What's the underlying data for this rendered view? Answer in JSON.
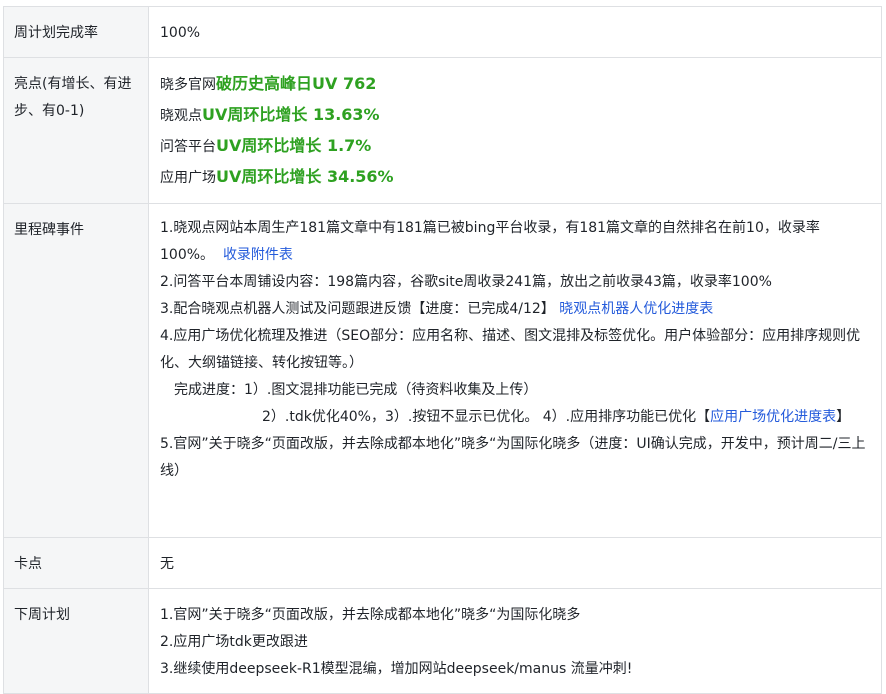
{
  "rows": [
    {
      "label": "周计划完成率",
      "value": "100%"
    },
    {
      "label": "亮点(有增长、有进步、有0-1)",
      "highlights": [
        {
          "prefix": "晓多官网",
          "stat": "破历史高峰日UV 762"
        },
        {
          "prefix": "晓观点",
          "stat": "UV周环比增长 13.63%"
        },
        {
          "prefix": "问答平台",
          "stat": "UV周环比增长 1.7%"
        },
        {
          "prefix": "应用广场",
          "stat": "UV周环比增长 34.56%"
        }
      ]
    },
    {
      "label": "里程碑事件",
      "m1_text": "1.晓观点网站本周生产181篇文章中有181篇已被bing平台收录，有181篇文章的自然排名在前10，收录率100%。",
      "m1_link": "收录附件表",
      "m2_text": "2.问答平台本周铺设内容：198篇内容，谷歌site周收录241篇，放出之前收录43篇，收录率100%",
      "m3_text": "3.配合晓观点机器人测试及问题跟进反馈【进度：已完成4/12】",
      "m3_link": "晓观点机器人优化进度表",
      "m4_text": "4.应用广场优化梳理及推进（SEO部分：应用名称、描述、图文混排及标签优化。用户体验部分：应用排序规则优化、大纲锚链接、转化按钮等。）",
      "m4_progress1": "完成进度：1）.图文混排功能已完成（待资料收集及上传）",
      "m4_progress2": "2）.tdk优化40%，3）.按钮不显示已优化。 4）.应用排序功能已优化【",
      "m4_link": "应用广场优化进度表",
      "m4_close": "】",
      "m5_text": "5.官网”关于晓多“页面改版，并去除成都本地化”晓多“为国际化晓多（进度：UI确认完成，开发中，预计周二/三上线）"
    },
    {
      "label": "卡点",
      "value": "无"
    },
    {
      "label": "下周计划",
      "items": [
        "1.官网”关于晓多“页面改版，并去除成都本地化”晓多“为国际化晓多",
        "2.应用广场tdk更改跟进",
        "3.继续使用deepseek-R1模型混编，增加网站deepseek/manus 流量冲刺!"
      ]
    }
  ]
}
